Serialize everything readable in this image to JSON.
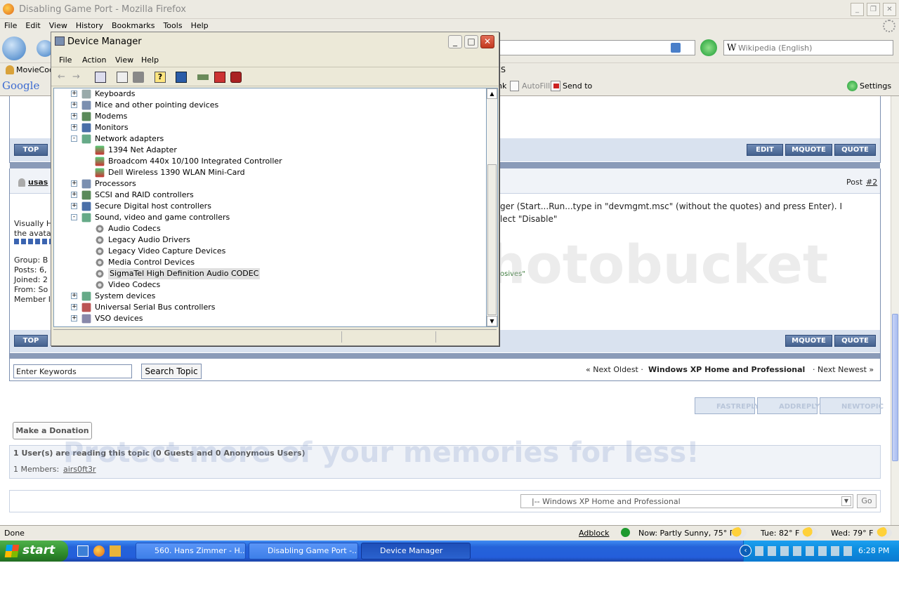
{
  "firefox": {
    "title": "Disabling Game Port - Mozilla Firefox",
    "menu": [
      "File",
      "Edit",
      "View",
      "History",
      "Bookmarks",
      "Tools",
      "Help"
    ],
    "search_placeholder": "Wikipedia (English)",
    "bookmarks": {
      "moviecod": "MovieCod",
      "trailing": "ES"
    },
    "google_label": "Google",
    "google_toolbar": {
      "link": "nk",
      "autofill": "AutoFill",
      "sendto": "Send to",
      "settings": "Settings"
    },
    "status": "Done"
  },
  "forum": {
    "top_label": "TOP",
    "edit_label": "EDIT",
    "mquote_label": "MQUOTE",
    "quote_label": "QUOTE",
    "poster": "usas",
    "post_label": "Post",
    "post_num": "#2",
    "post_text_1": "ger (Start...Run...type in \"devmgmt.msc\" (without the quotes) and press Enter). I",
    "post_text_2": "lect \"Disable\"",
    "sig_text": "osives\"",
    "side": [
      "Visually H",
      "the avata",
      "Group: B",
      "Posts: 6,",
      "Joined: 2",
      "From: So",
      "Member I"
    ],
    "keywords_placeholder": "Enter Keywords",
    "search_topic": "Search Topic",
    "nav_prefix": "« Next Oldest ·",
    "nav_title": "Windows XP Home and Professional",
    "nav_suffix": "· Next Newest »",
    "fastreply": "FASTREPLY",
    "addreply": "ADDREPLY",
    "newtopic": "NEWTOPIC",
    "donate": "Make a Donation",
    "readers": "1 User(s) are reading this topic (0 Guests and 0 Anonymous Users)",
    "members_label": "1 Members:",
    "member_name": "airs0ft3r",
    "jump_select": "|-- Windows XP Home and Professional",
    "go": "Go",
    "watermark_1": "photobucket",
    "watermark_2": "Protect more of your memories for less!"
  },
  "statusbar": {
    "adblock": "Adblock",
    "now": "Now: Partly Sunny, 75° F",
    "tue": "Tue: 82° F",
    "wed": "Wed: 79° F"
  },
  "taskbar": {
    "start": "start",
    "tasks": [
      "560. Hans Zimmer - H...",
      "Disabling Game Port -...",
      "Device Manager"
    ],
    "clock": "6:28 PM"
  },
  "device_manager": {
    "title": "Device Manager",
    "menu": [
      "File",
      "Action",
      "View",
      "Help"
    ],
    "tree": [
      {
        "label": "Keyboards",
        "level": 0,
        "expander": "+"
      },
      {
        "label": "Mice and other pointing devices",
        "level": 0,
        "expander": "+"
      },
      {
        "label": "Modems",
        "level": 0,
        "expander": "+"
      },
      {
        "label": "Monitors",
        "level": 0,
        "expander": "+"
      },
      {
        "label": "Network adapters",
        "level": 0,
        "expander": "-"
      },
      {
        "label": "1394 Net Adapter",
        "level": 1
      },
      {
        "label": "Broadcom 440x 10/100 Integrated Controller",
        "level": 1
      },
      {
        "label": "Dell Wireless 1390 WLAN Mini-Card",
        "level": 1
      },
      {
        "label": "Processors",
        "level": 0,
        "expander": "+"
      },
      {
        "label": "SCSI and RAID controllers",
        "level": 0,
        "expander": "+"
      },
      {
        "label": "Secure Digital host controllers",
        "level": 0,
        "expander": "+"
      },
      {
        "label": "Sound, video and game controllers",
        "level": 0,
        "expander": "-"
      },
      {
        "label": "Audio Codecs",
        "level": 1
      },
      {
        "label": "Legacy Audio Drivers",
        "level": 1
      },
      {
        "label": "Legacy Video Capture Devices",
        "level": 1
      },
      {
        "label": "Media Control Devices",
        "level": 1
      },
      {
        "label": "SigmaTel High Definition Audio CODEC",
        "level": 1,
        "selected": true
      },
      {
        "label": "Video Codecs",
        "level": 1
      },
      {
        "label": "System devices",
        "level": 0,
        "expander": "+"
      },
      {
        "label": "Universal Serial Bus controllers",
        "level": 0,
        "expander": "+"
      },
      {
        "label": "VSO devices",
        "level": 0,
        "expander": "+"
      }
    ]
  }
}
